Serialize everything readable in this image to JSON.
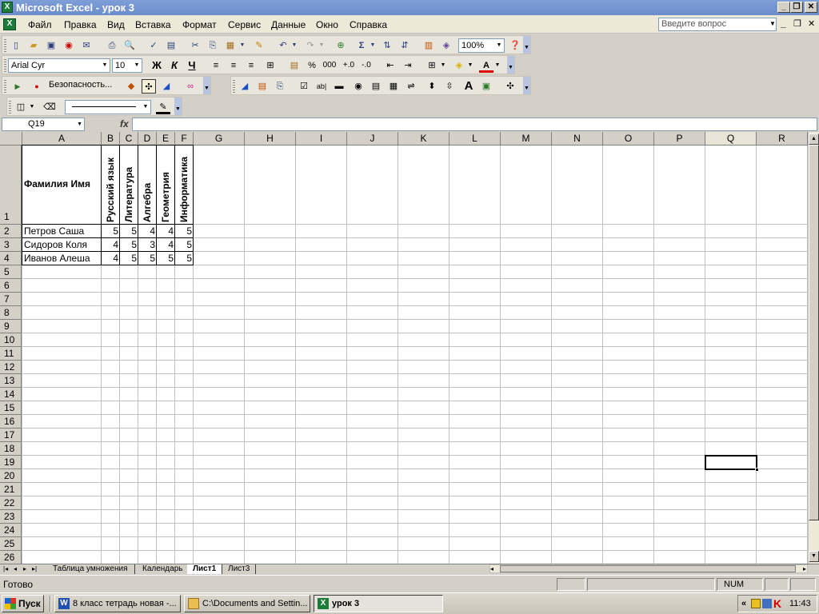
{
  "window": {
    "title": "Microsoft Excel - урок 3",
    "icon": "excel-app-icon"
  },
  "menu": {
    "items": [
      "Файл",
      "Правка",
      "Вид",
      "Вставка",
      "Формат",
      "Сервис",
      "Данные",
      "Окно",
      "Справка"
    ],
    "ask_placeholder": "Введите вопрос"
  },
  "toolbar": {
    "zoom": "100%",
    "font_name": "Arial Cyr",
    "font_size": "10",
    "bold": "Ж",
    "italic": "К",
    "underline": "Ч",
    "percent": "%",
    "thousands": "000",
    "security_label": "Безопасность..."
  },
  "formula_bar": {
    "name_box": "Q19",
    "fx_label": "fx",
    "formula": ""
  },
  "columns": [
    "A",
    "B",
    "C",
    "D",
    "E",
    "F",
    "G",
    "H",
    "I",
    "J",
    "K",
    "L",
    "M",
    "N",
    "O",
    "P",
    "Q",
    "R"
  ],
  "active_column": "Q",
  "active_cell": "Q19",
  "rows": [
    "1",
    "2",
    "3",
    "4",
    "5",
    "6",
    "7",
    "8",
    "9",
    "10",
    "11",
    "12",
    "13",
    "14",
    "15",
    "16",
    "17",
    "18",
    "19",
    "20",
    "21",
    "22",
    "23",
    "24",
    "25",
    "26"
  ],
  "sheet": {
    "header_name": "Фамилия Имя",
    "subjects": [
      "Русский язык",
      "Литература",
      "Алгебра",
      "Геометрия",
      "Информатика"
    ],
    "students": [
      {
        "name": "Петров Саша",
        "grades": [
          "5",
          "5",
          "4",
          "4",
          "5"
        ]
      },
      {
        "name": "Сидоров Коля",
        "grades": [
          "4",
          "5",
          "3",
          "4",
          "5"
        ]
      },
      {
        "name": "Иванов Алеша",
        "grades": [
          "4",
          "5",
          "5",
          "5",
          "5"
        ]
      }
    ]
  },
  "tabs": [
    "Таблица умножения",
    "Календарь",
    "Лист1",
    "Лист3"
  ],
  "active_tab": "Лист1",
  "status": {
    "ready": "Готово",
    "num": "NUM"
  },
  "taskbar": {
    "start": "Пуск",
    "tasks": [
      "8 класс тетрадь новая -...",
      "C:\\Documents and Settin...",
      "урок 3"
    ],
    "clock": "11:43"
  }
}
